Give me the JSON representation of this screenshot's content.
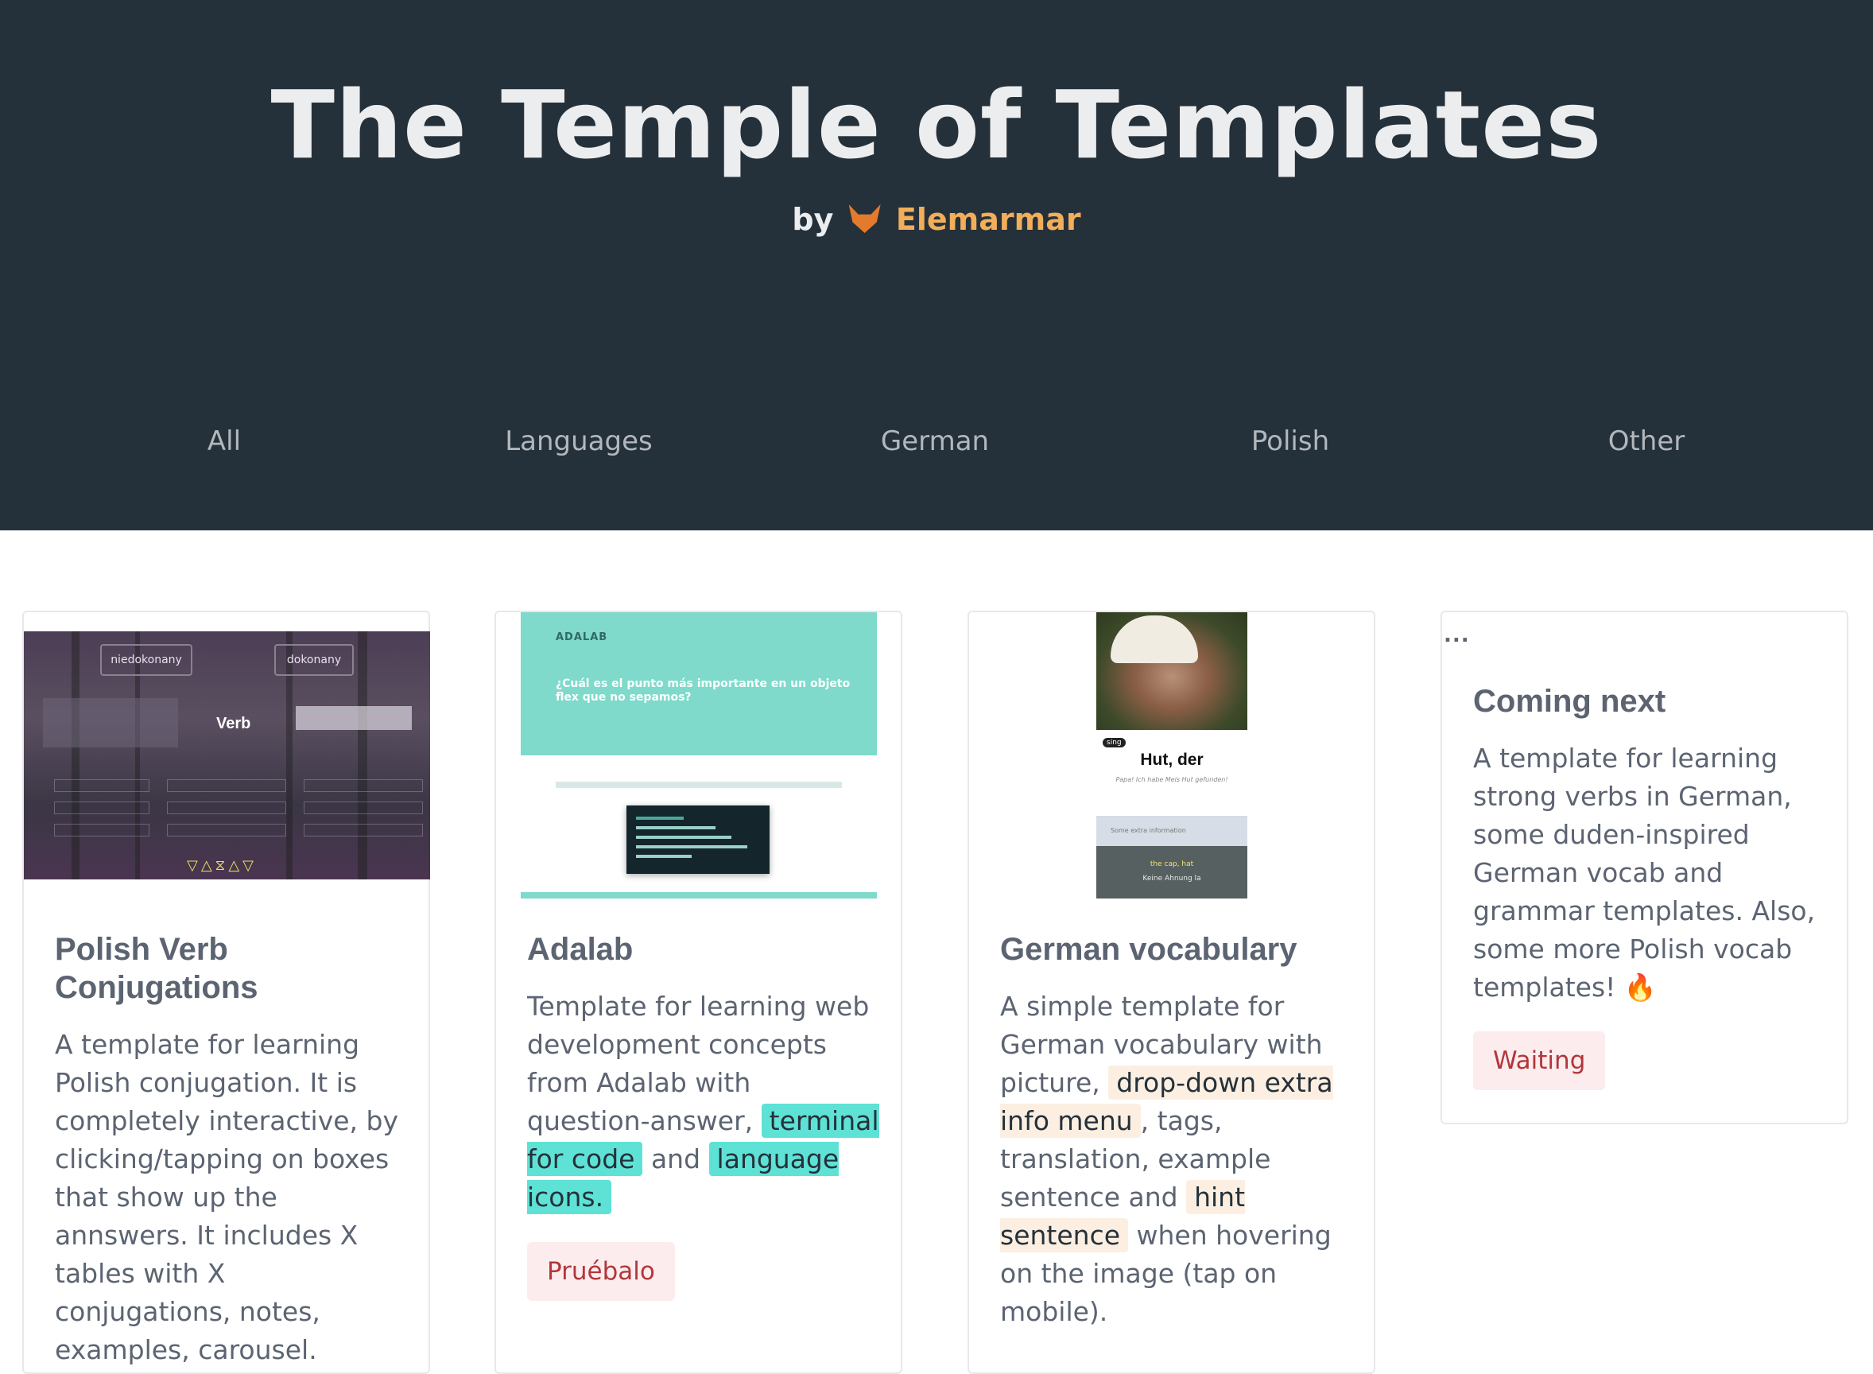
{
  "header": {
    "title": "The Temple of Templates",
    "by": "by",
    "author": "Elemarmar",
    "author_icon": "fox-icon"
  },
  "nav": [
    {
      "label": "All"
    },
    {
      "label": "Languages"
    },
    {
      "label": "German"
    },
    {
      "label": "Polish"
    },
    {
      "label": "Other"
    }
  ],
  "cards": [
    {
      "title": "Polish Verb Conjugations",
      "text": "A template for learning Polish conjugation. It is completely interactive, by clicking/tapping on boxes that show up the annswers. It includes X tables with X conjugations, notes, examples, carousel.",
      "preview": {
        "tag_left": "niedokonany",
        "tag_right": "dokonany",
        "center": "Verb",
        "glyphs": "▽△⧖△▽"
      }
    },
    {
      "title": "Adalab",
      "text_1": "Template for learning web development concepts from Adalab with question-answer,",
      "hl_1": "terminal for code",
      "text_2": "and",
      "hl_2": "language icons.",
      "button": "Pruébalo",
      "preview": {
        "logo": "ADALAB",
        "question": "¿Cuál es el punto más importante en un objeto flex que no sepamos?"
      }
    },
    {
      "title": "German vocabulary",
      "text_1": "A simple template for German vocabulary with picture,",
      "hl_1": "drop-down extra info menu",
      "text_2": ", tags, translation, example sentence and",
      "hl_2": "hint sentence",
      "text_3": "when hovering on the image (tap on mobile).",
      "preview": {
        "tag": "sing",
        "word": "Hut, der",
        "sentence": "Papa! Ich habe Meis Hut gefunden!",
        "extra": "Some extra information",
        "translation": "the cap, hat",
        "hint": "Keine Ahnung la"
      }
    },
    {
      "dots": "...",
      "title": "Coming next",
      "text": "A template for learning strong verbs in German, some duden-inspired German vocab and grammar templates. Also, some more Polish vocab templates! 🔥",
      "badge": "Waiting"
    }
  ]
}
